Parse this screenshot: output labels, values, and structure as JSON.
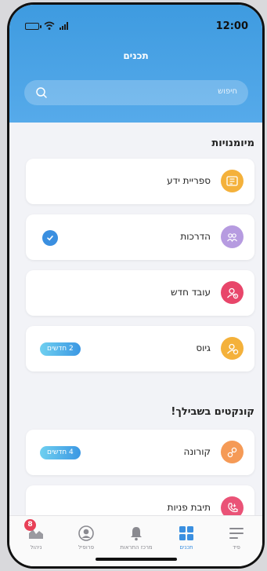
{
  "status_bar": {
    "time": "12:00"
  },
  "header": {
    "title": "תכנים"
  },
  "search": {
    "placeholder": "חיפוש"
  },
  "sections": [
    {
      "title": "מיומנויות"
    },
    {
      "title": "קונקטים בשבילך!"
    }
  ],
  "cards": [
    {
      "label": "ספריית ידע",
      "icon": "library-icon",
      "color": "#f4b13b"
    },
    {
      "label": "הדרכות",
      "icon": "training-icon",
      "color": "#b69be0",
      "checked": true
    },
    {
      "label": "עובד חדש",
      "icon": "new-employee-icon",
      "color": "#e8466a"
    },
    {
      "label": "גיוס",
      "icon": "recruitment-icon",
      "color": "#f4b13b",
      "badge": "2 חדשים"
    },
    {
      "label": "קורונה",
      "icon": "corona-icon",
      "color": "#f59a56",
      "badge": "4 חדשים"
    },
    {
      "label": "תיבת פניות",
      "icon": "inquiries-icon",
      "color": "#ea5377"
    }
  ],
  "tabbar": {
    "items": [
      {
        "label": "ניהול",
        "badge": "8"
      },
      {
        "label": "פרופיל"
      },
      {
        "label": "מרכז התראות"
      },
      {
        "label": "תכנים"
      },
      {
        "label": "פיד"
      }
    ]
  },
  "colors": {
    "accent": "#3a8fe0",
    "header": "#4aa3e6"
  }
}
